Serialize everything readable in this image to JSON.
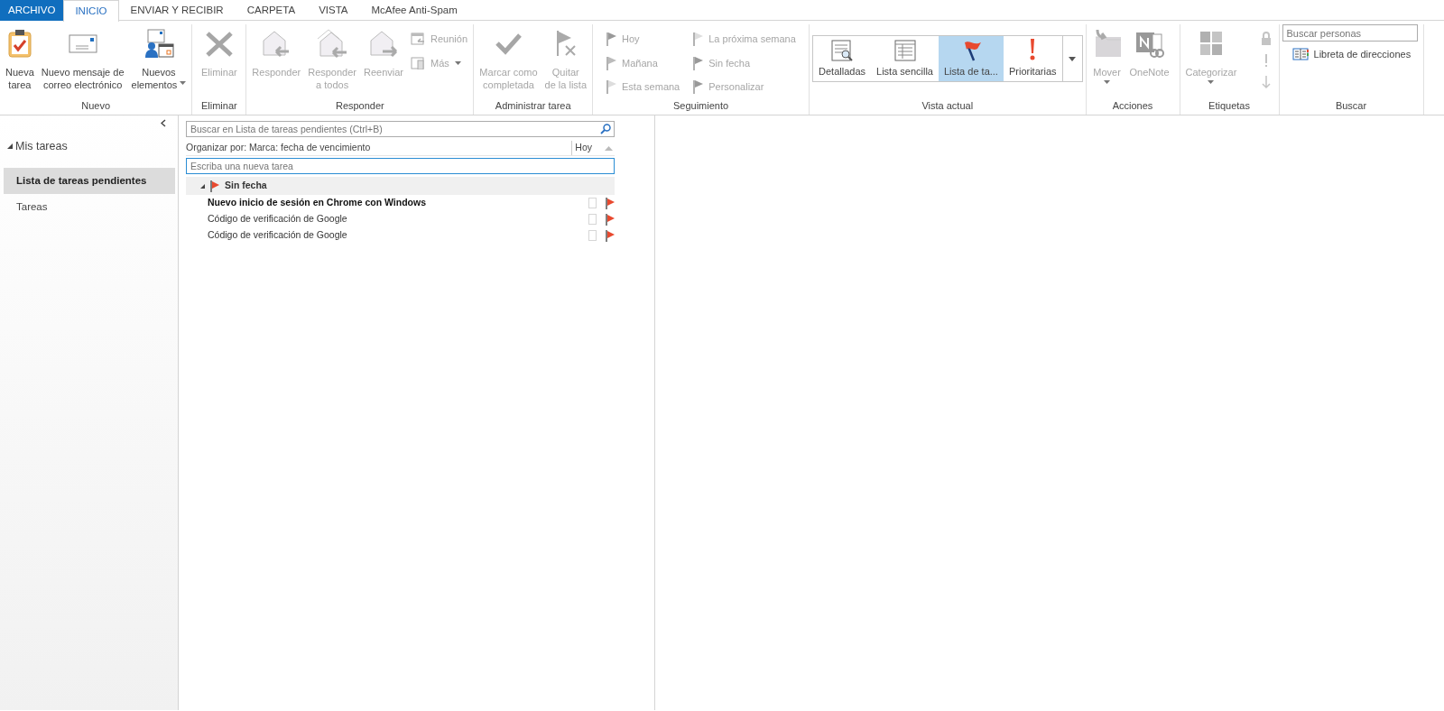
{
  "ribbon_tabs": [
    {
      "label": "ARCHIVO",
      "kind": "file",
      "selected": false
    },
    {
      "label": "INICIO",
      "kind": "tab",
      "selected": true
    },
    {
      "label": "ENVIAR Y RECIBIR",
      "kind": "tab",
      "selected": false
    },
    {
      "label": "CARPETA",
      "kind": "tab",
      "selected": false
    },
    {
      "label": "VISTA",
      "kind": "tab",
      "selected": false
    },
    {
      "label": "McAfee Anti-Spam",
      "kind": "tab",
      "selected": false
    }
  ],
  "ribbon_groups": [
    {
      "label": "Nuevo",
      "items": [
        {
          "kind": "large",
          "label": "Nueva\ntarea",
          "disabled": false,
          "dropdown": false
        },
        {
          "kind": "large",
          "label": "Nuevo mensaje de\ncorreo electrónico",
          "disabled": false,
          "dropdown": false
        },
        {
          "kind": "large",
          "label": "Nuevos\nelementos",
          "disabled": false,
          "dropdown": true
        }
      ]
    },
    {
      "label": "Eliminar",
      "items": [
        {
          "kind": "large",
          "label": "Eliminar",
          "disabled": true,
          "dropdown": false
        }
      ]
    },
    {
      "label": "Responder",
      "items": [
        {
          "kind": "large",
          "label": "Responder",
          "disabled": true,
          "dropdown": false
        },
        {
          "kind": "large",
          "label": "Responder\na todos",
          "disabled": true,
          "dropdown": false
        },
        {
          "kind": "large",
          "label": "Reenviar",
          "disabled": true,
          "dropdown": false
        },
        {
          "kind": "small",
          "label": "Reunión",
          "disabled": true,
          "dropdown": false
        },
        {
          "kind": "small",
          "label": "Más",
          "disabled": true,
          "dropdown": true
        }
      ]
    },
    {
      "label": "Administrar tarea",
      "items": [
        {
          "kind": "large",
          "label": "Marcar como\ncompletada",
          "disabled": true,
          "dropdown": false
        },
        {
          "kind": "large",
          "label": "Quitar\nde la lista",
          "disabled": true,
          "dropdown": false
        }
      ]
    },
    {
      "label": "Seguimiento",
      "items": [
        {
          "kind": "small",
          "label": "Hoy",
          "disabled": true,
          "dropdown": false
        },
        {
          "kind": "small",
          "label": "Mañana",
          "disabled": true,
          "dropdown": false
        },
        {
          "kind": "small",
          "label": "Esta semana",
          "disabled": true,
          "dropdown": false
        },
        {
          "kind": "small",
          "label": "La próxima semana",
          "disabled": true,
          "dropdown": false
        },
        {
          "kind": "small",
          "label": "Sin fecha",
          "disabled": true,
          "dropdown": false
        },
        {
          "kind": "small",
          "label": "Personalizar",
          "disabled": true,
          "dropdown": false
        }
      ]
    },
    {
      "label": "Vista actual",
      "items": [
        {
          "kind": "gallery",
          "label": "Detalladas",
          "selected": false
        },
        {
          "kind": "gallery",
          "label": "Lista sencilla",
          "selected": false
        },
        {
          "kind": "gallery",
          "label": "Lista de ta...",
          "selected": true
        },
        {
          "kind": "gallery",
          "label": "Prioritarias",
          "selected": false
        }
      ]
    },
    {
      "label": "Acciones",
      "items": [
        {
          "kind": "large",
          "label": "Mover",
          "disabled": true,
          "dropdown": true
        },
        {
          "kind": "large",
          "label": "OneNote",
          "disabled": true,
          "dropdown": false
        }
      ]
    },
    {
      "label": "Etiquetas",
      "items": [
        {
          "kind": "large",
          "label": "Categorizar",
          "disabled": true,
          "dropdown": true
        },
        {
          "kind": "icon",
          "disabled": true
        },
        {
          "kind": "icon",
          "disabled": true
        },
        {
          "kind": "icon",
          "disabled": true
        }
      ]
    },
    {
      "label": "Buscar",
      "items": [
        {
          "kind": "search",
          "placeholder": "Buscar personas"
        },
        {
          "kind": "small",
          "label": "Libreta de direcciones",
          "disabled": false,
          "dropdown": false
        }
      ]
    }
  ],
  "navigation": {
    "title": "Mis tareas",
    "expanded": true,
    "items": [
      {
        "label": "Lista de tareas pendientes",
        "selected": true
      },
      {
        "label": "Tareas",
        "selected": false
      }
    ]
  },
  "task_list": {
    "search": {
      "placeholder": "Buscar en Lista de tareas pendientes (Ctrl+B)"
    },
    "arrange_by": "Organizar por: Marca: fecha de vencimiento",
    "sort_column": "Hoy",
    "new_task": {
      "placeholder": "Escriba una nueva tarea"
    },
    "groups": [
      {
        "label": "Sin fecha",
        "expanded": true,
        "tasks": [
          {
            "subject": "Nuevo inicio de sesión en Chrome con Windows",
            "unread": true,
            "checked": false,
            "flagged": true
          },
          {
            "subject": "Código de verificación de Google",
            "unread": false,
            "checked": false,
            "flagged": true
          },
          {
            "subject": "Código de verificación de Google",
            "unread": false,
            "checked": false,
            "flagged": true
          }
        ]
      }
    ]
  }
}
